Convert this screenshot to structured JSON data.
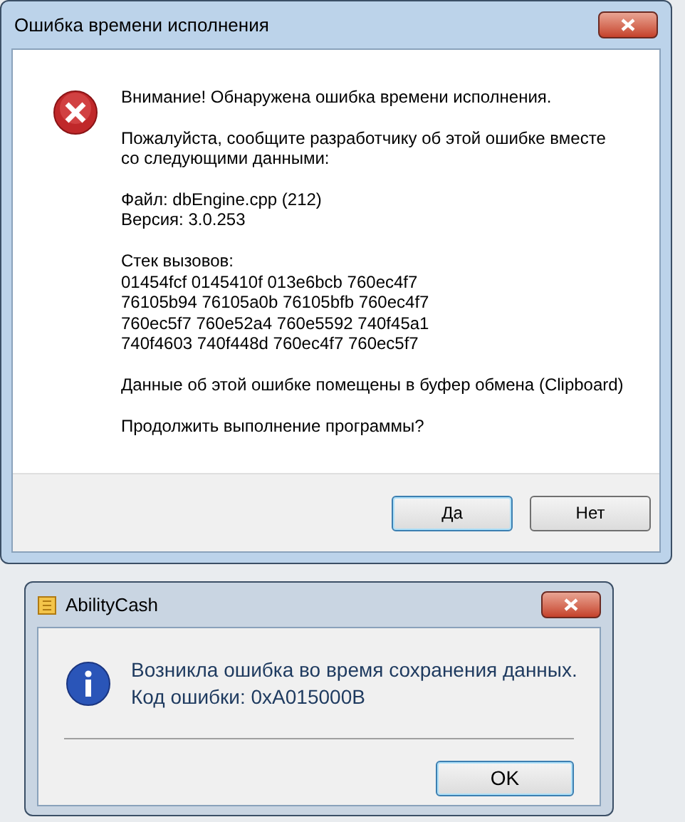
{
  "error_dialog": {
    "title": "Ошибка времени исполнения",
    "paragraphs": [
      [
        "Внимание! Обнаружена ошибка времени исполнения."
      ],
      [
        "Пожалуйста, сообщите разработчику об этой ошибке вместе",
        "со следующими данными:"
      ],
      [
        "Файл: dbEngine.cpp (212)",
        "Версия: 3.0.253"
      ],
      [
        "Стек вызовов:",
        "01454fcf 0145410f 013e6bcb 760ec4f7",
        "76105b94 76105a0b 76105bfb 760ec4f7",
        "760ec5f7 760e52a4 760e5592 740f45a1",
        "740f4603 740f448d 760ec4f7 760ec5f7"
      ],
      [
        "Данные об этой ошибке помещены в буфер обмена (Clipboard)"
      ],
      [
        "Продолжить выполнение программы?"
      ]
    ],
    "buttons": [
      {
        "label": "Да",
        "selected": true
      },
      {
        "label": "Нет",
        "selected": false
      }
    ]
  },
  "info_dialog": {
    "title": "AbilityCash",
    "message": [
      "Возникла ошибка во время сохранения данных.",
      "Код ошибки: 0xA015000B"
    ],
    "buttons": [
      {
        "label": "OK",
        "selected": true
      }
    ]
  }
}
